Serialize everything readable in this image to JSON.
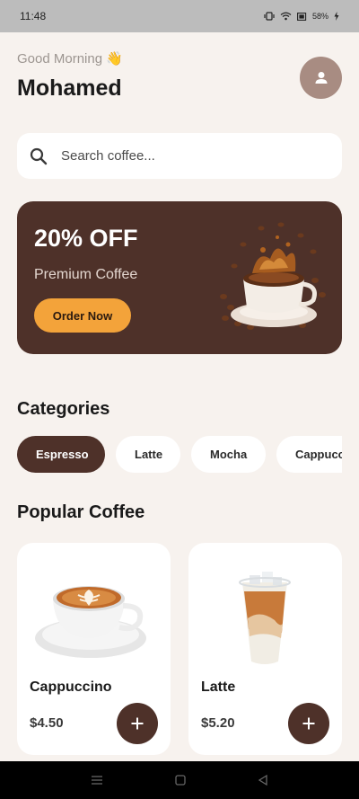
{
  "status_bar": {
    "time": "11:48",
    "battery": "58%"
  },
  "header": {
    "greeting": "Good Morning 👋",
    "user_name": "Mohamed"
  },
  "search": {
    "placeholder": "Search coffee..."
  },
  "promo": {
    "title": "20% OFF",
    "subtitle": "Premium Coffee",
    "button_label": "Order Now"
  },
  "categories": {
    "title": "Categories",
    "items": [
      {
        "label": "Espresso",
        "active": true
      },
      {
        "label": "Latte",
        "active": false
      },
      {
        "label": "Mocha",
        "active": false
      },
      {
        "label": "Cappuccino",
        "active": false
      }
    ]
  },
  "popular": {
    "title": "Popular Coffee",
    "items": [
      {
        "name": "Cappuccino",
        "price": "$4.50"
      },
      {
        "name": "Latte",
        "price": "$5.20"
      }
    ]
  },
  "colors": {
    "brand": "#4e3129",
    "accent": "#f3a33a",
    "background": "#f7f2ee",
    "avatar": "#a88c82"
  },
  "icons": {
    "search": "search-icon",
    "avatar": "person-icon",
    "add": "plus-icon"
  }
}
